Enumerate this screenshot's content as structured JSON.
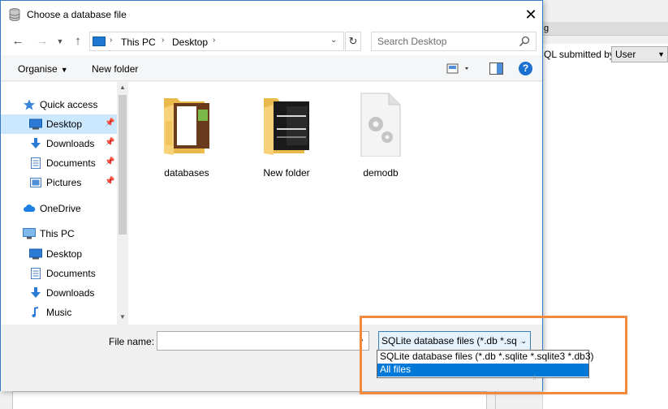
{
  "background_app": {
    "strip_text": "g",
    "label": "QL submitted by",
    "select_value": "User"
  },
  "dialog": {
    "title": "Choose a database file",
    "close_glyph": "✕"
  },
  "address_bar": {
    "back_glyph": "←",
    "forward_glyph": "→",
    "up_glyph": "↑",
    "crumbs": [
      "This PC",
      "Desktop"
    ],
    "refresh_glyph": "↻",
    "search_placeholder": "Search Desktop"
  },
  "toolbar": {
    "organise_label": "Organise",
    "new_folder_label": "New folder",
    "help_glyph": "?"
  },
  "nav_pane": {
    "items": [
      {
        "label": "Quick access",
        "icon": "star-icon"
      },
      {
        "label": "Desktop",
        "icon": "desktop-icon",
        "pinned": true,
        "selected": true
      },
      {
        "label": "Downloads",
        "icon": "download-icon",
        "pinned": true
      },
      {
        "label": "Documents",
        "icon": "documents-icon",
        "pinned": true
      },
      {
        "label": "Pictures",
        "icon": "pictures-icon",
        "pinned": true
      },
      {
        "label": "OneDrive",
        "icon": "cloud-icon"
      },
      {
        "label": "This PC",
        "icon": "computer-icon"
      },
      {
        "label": "Desktop",
        "icon": "desktop-icon"
      },
      {
        "label": "Documents",
        "icon": "documents-icon"
      },
      {
        "label": "Downloads",
        "icon": "download-icon"
      },
      {
        "label": "Music",
        "icon": "music-icon"
      }
    ]
  },
  "files": [
    {
      "name": "databases",
      "type": "folder"
    },
    {
      "name": "New folder",
      "type": "folder"
    },
    {
      "name": "demodb",
      "type": "file"
    }
  ],
  "bottom": {
    "file_name_label": "File name:",
    "file_name_value": "",
    "file_type_selected": "SQLite database files (*.db *.sql",
    "file_type_options": [
      "SQLite database files (*.db *.sqlite *.sqlite3 *.db3)",
      "All files"
    ],
    "highlighted_option": "All files"
  },
  "colors": {
    "selection": "#cce8ff",
    "dropdown_highlight": "#0078d7",
    "annotation": "#f28a3b",
    "folder": "#f3c55f"
  }
}
